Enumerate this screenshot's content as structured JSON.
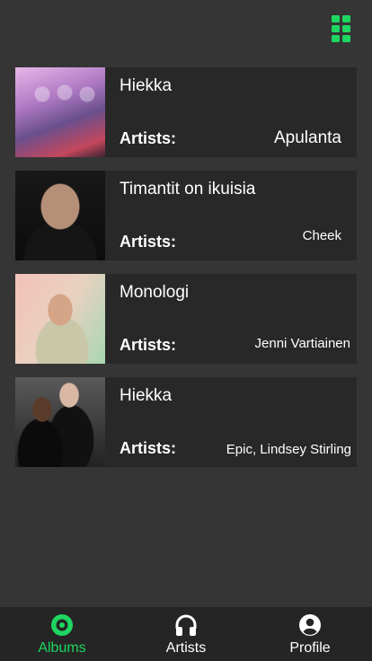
{
  "header": {
    "grid_icon": "grid-icon"
  },
  "albums": [
    {
      "title": "Hiekka",
      "artists_label": "Artists:",
      "artists": "Apulanta"
    },
    {
      "title": "Timantit on ikuisia",
      "artists_label": "Artists:",
      "artists": "Cheek"
    },
    {
      "title": "Monologi",
      "artists_label": "Artists:",
      "artists": "Jenni Vartiainen"
    },
    {
      "title": "Hiekka",
      "artists_label": "Artists:",
      "artists": "Epic, Lindsey Stirling"
    }
  ],
  "tabs": [
    {
      "label": "Albums",
      "icon": "disc-icon",
      "active": true
    },
    {
      "label": "Artists",
      "icon": "headphones-icon",
      "active": false
    },
    {
      "label": "Profile",
      "icon": "user-circle-icon",
      "active": false
    }
  ],
  "colors": {
    "accent": "#1ed760",
    "background": "#353535",
    "card": "#282828",
    "tabbar": "#252525"
  }
}
